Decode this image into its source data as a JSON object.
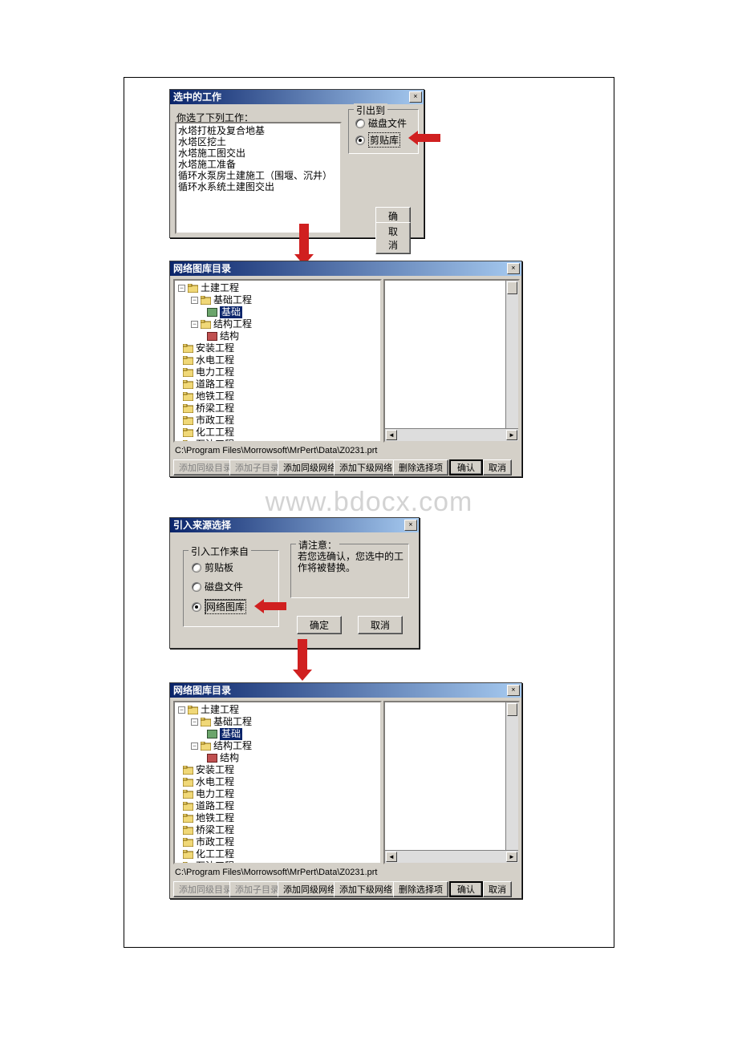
{
  "watermark": "www.bdocx.com",
  "dialog1": {
    "title": "选中的工作",
    "list_header": "你选了下列工作：",
    "items": [
      "水塔打桩及复合地基",
      "水塔区挖土",
      "水塔施工图交出",
      "水塔施工准备",
      "循环水泵房土建施工（围堰、沉井）",
      "循环水系统土建图交出"
    ],
    "group_export": "引出到",
    "radio_disk": "磁盘文件",
    "radio_lib": "剪贴库",
    "btn_ok": "确认",
    "btn_cancel": "取消"
  },
  "tree_dialog": {
    "title": "网络图库目录",
    "path": "C:\\Program Files\\Morrowsoft\\MrPert\\Data\\Z0231.prt",
    "btns": {
      "add_sibling": "添加同级目录",
      "add_child": "添加子目录",
      "add_net_sibling": "添加同级网络",
      "add_net_child": "添加下级网络",
      "del_sel": "删除选择项",
      "ok": "确认",
      "cancel": "取消"
    },
    "tree": {
      "root": "土建工程",
      "child1": "基础工程",
      "leaf1": "基础",
      "child2": "结构工程",
      "leaf2": "结构",
      "items": [
        "安装工程",
        "水电工程",
        "电力工程",
        "道路工程",
        "地铁工程",
        "桥梁工程",
        "市政工程",
        "化工工程",
        "石油工程"
      ]
    }
  },
  "dialog3": {
    "title": "引入来源选择",
    "group_from": "引入工作来自",
    "radio_clip": "剪贴板",
    "radio_disk": "磁盘文件",
    "radio_lib": "网络图库",
    "group_note": "请注意：",
    "note_text": "若您选确认，您选中的工作将被替换。",
    "btn_ok": "确定",
    "btn_cancel": "取消"
  }
}
